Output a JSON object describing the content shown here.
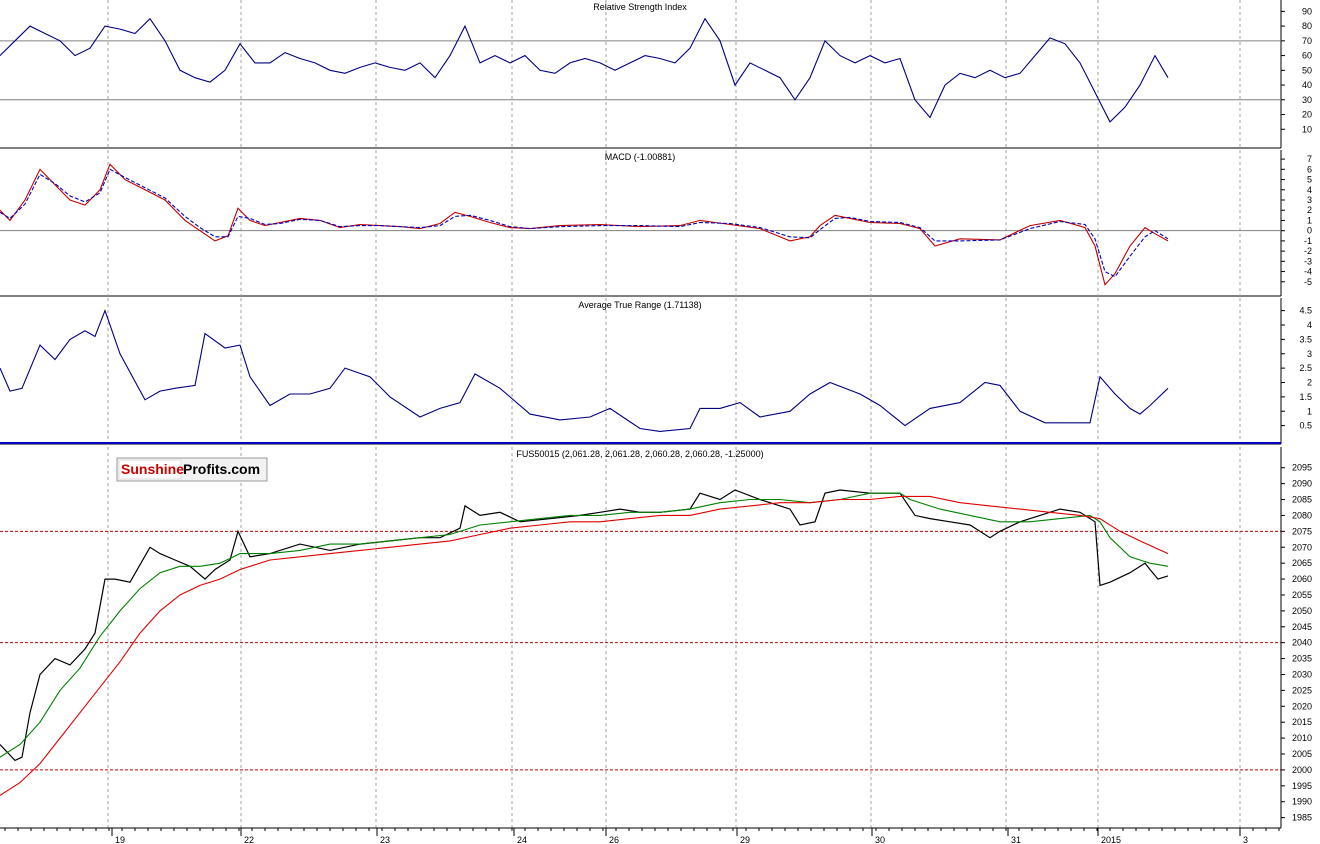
{
  "logo": {
    "sunshine": "Sunshine",
    "profits": "Profits.com"
  },
  "x_axis": {
    "labels": [
      "19",
      "22",
      "23",
      "24",
      "26",
      "29",
      "30",
      "31",
      "2015",
      "3"
    ]
  },
  "chart_data": [
    {
      "type": "line",
      "title": "Relative Strength Index",
      "ylim": [
        0,
        95
      ],
      "yticks": [
        10,
        20,
        30,
        40,
        50,
        60,
        70,
        80,
        90
      ],
      "reference_lines": [
        30,
        70
      ],
      "grid": true,
      "colors": {
        "series": "#000080"
      },
      "series": [
        {
          "x": [
            0,
            15,
            30,
            45,
            60,
            75,
            90,
            105,
            120,
            135,
            150,
            165,
            180,
            195,
            210,
            225,
            240,
            255,
            270,
            285,
            300,
            315,
            330,
            345,
            360,
            375,
            390,
            405,
            420,
            435,
            450,
            465,
            480,
            495,
            510,
            525,
            540,
            555,
            570,
            585,
            600,
            615,
            630,
            645,
            660,
            675,
            690,
            705,
            720,
            735,
            750,
            765,
            780,
            795,
            810,
            825,
            840,
            855,
            870,
            885,
            900,
            915,
            930,
            945,
            960,
            975,
            990,
            1005,
            1020,
            1035,
            1050,
            1065,
            1080,
            1095,
            1110,
            1125,
            1140,
            1155,
            1168
          ],
          "values": [
            60,
            70,
            80,
            75,
            70,
            60,
            65,
            80,
            78,
            75,
            85,
            70,
            50,
            45,
            42,
            50,
            68,
            55,
            55,
            62,
            58,
            55,
            50,
            48,
            52,
            55,
            52,
            50,
            55,
            45,
            60,
            80,
            55,
            60,
            55,
            60,
            50,
            48,
            55,
            58,
            55,
            50,
            55,
            60,
            58,
            55,
            65,
            85,
            70,
            40,
            55,
            50,
            45,
            30,
            45,
            70,
            60,
            55,
            60,
            55,
            58,
            30,
            18,
            40,
            48,
            45,
            50,
            45,
            48,
            60,
            72,
            68,
            55,
            35,
            15,
            25,
            40,
            60,
            45
          ]
        }
      ]
    },
    {
      "type": "line",
      "title": "MACD (-1.00881)",
      "ylim": [
        -6,
        7.5
      ],
      "yticks": [
        -5,
        -4,
        -3,
        -2,
        -1,
        0,
        1,
        2,
        3,
        4,
        5,
        6,
        7
      ],
      "reference_lines": [
        0
      ],
      "grid": true,
      "colors": {
        "macd": "#c00000",
        "signal": "#0000c0"
      },
      "series": [
        {
          "x": [
            0,
            10,
            25,
            40,
            55,
            70,
            85,
            100,
            110,
            125,
            145,
            165,
            185,
            200,
            215,
            228,
            238,
            250,
            265,
            280,
            300,
            320,
            340,
            360,
            380,
            400,
            420,
            440,
            455,
            470,
            490,
            510,
            530,
            560,
            600,
            640,
            680,
            700,
            730,
            760,
            790,
            810,
            820,
            835,
            850,
            870,
            900,
            920,
            935,
            960,
            1000,
            1030,
            1060,
            1085,
            1095,
            1105,
            1115,
            1130,
            1145,
            1155,
            1168
          ],
          "values": [
            2,
            1,
            3,
            6,
            4.5,
            3,
            2.5,
            4,
            6.5,
            5,
            4,
            3,
            1,
            0,
            -1,
            -0.5,
            2.2,
            1,
            0.5,
            0.8,
            1.2,
            1,
            0.3,
            0.6,
            0.5,
            0.4,
            0.2,
            0.7,
            1.8,
            1.4,
            0.8,
            0.3,
            0.2,
            0.5,
            0.6,
            0.4,
            0.5,
            1,
            0.6,
            0.2,
            -1,
            -0.6,
            0.5,
            1.5,
            1.2,
            0.8,
            0.7,
            0.2,
            -1.5,
            -0.8,
            -0.9,
            0.5,
            1,
            0.3,
            -1.5,
            -5.3,
            -4.2,
            -1.5,
            0.3,
            -0.3,
            -1
          ]
        },
        {
          "x": [
            0,
            10,
            25,
            40,
            55,
            70,
            85,
            100,
            110,
            125,
            145,
            165,
            185,
            200,
            215,
            228,
            238,
            250,
            265,
            280,
            300,
            320,
            340,
            360,
            380,
            400,
            420,
            440,
            455,
            470,
            490,
            510,
            530,
            560,
            600,
            640,
            680,
            700,
            730,
            760,
            790,
            810,
            820,
            835,
            850,
            870,
            900,
            920,
            935,
            960,
            1000,
            1030,
            1060,
            1085,
            1095,
            1105,
            1115,
            1130,
            1145,
            1155,
            1168
          ],
          "values": [
            1.8,
            1.2,
            2.6,
            5.5,
            4.6,
            3.4,
            2.8,
            3.7,
            6,
            5.2,
            4.2,
            3.2,
            1.4,
            0.3,
            -0.6,
            -0.6,
            1.4,
            1.2,
            0.6,
            0.7,
            1.1,
            1,
            0.4,
            0.5,
            0.5,
            0.4,
            0.3,
            0.5,
            1.4,
            1.5,
            1,
            0.4,
            0.2,
            0.4,
            0.5,
            0.5,
            0.4,
            0.8,
            0.7,
            0.3,
            -0.6,
            -0.7,
            0.1,
            1.2,
            1.3,
            0.9,
            0.8,
            0.3,
            -1,
            -1,
            -0.9,
            0.2,
            0.9,
            0.6,
            -0.8,
            -4,
            -4.5,
            -2.5,
            -0.6,
            0,
            -0.8
          ]
        }
      ]
    },
    {
      "type": "line",
      "title": "Average True Range (1.71138)",
      "ylim": [
        0,
        4.8
      ],
      "yticks": [
        0.5,
        1.0,
        1.5,
        2.0,
        2.5,
        3.0,
        3.5,
        4.0,
        4.5
      ],
      "grid": true,
      "colors": {
        "series": "#000080"
      },
      "series": [
        {
          "x": [
            0,
            10,
            22,
            40,
            55,
            70,
            85,
            95,
            105,
            120,
            145,
            160,
            175,
            195,
            205,
            225,
            240,
            250,
            270,
            290,
            310,
            330,
            345,
            370,
            390,
            420,
            440,
            460,
            475,
            500,
            530,
            560,
            590,
            610,
            640,
            660,
            690,
            700,
            720,
            740,
            760,
            790,
            810,
            830,
            860,
            880,
            905,
            930,
            960,
            985,
            1000,
            1020,
            1045,
            1070,
            1090,
            1100,
            1115,
            1130,
            1140,
            1150,
            1168
          ],
          "values": [
            2.5,
            1.7,
            1.8,
            3.3,
            2.8,
            3.5,
            3.8,
            3.6,
            4.5,
            3,
            1.4,
            1.7,
            1.8,
            1.9,
            3.7,
            3.2,
            3.3,
            2.2,
            1.2,
            1.6,
            1.6,
            1.8,
            2.5,
            2.2,
            1.5,
            0.8,
            1.1,
            1.3,
            2.3,
            1.8,
            0.9,
            0.7,
            0.8,
            1.1,
            0.4,
            0.3,
            0.4,
            1.1,
            1.1,
            1.3,
            0.8,
            1.0,
            1.6,
            2.0,
            1.6,
            1.2,
            0.5,
            1.1,
            1.3,
            2.0,
            1.9,
            1.0,
            0.6,
            0.6,
            0.6,
            2.2,
            1.6,
            1.1,
            0.9,
            1.2,
            1.8
          ]
        }
      ]
    },
    {
      "type": "line",
      "title": "FUS50015 (2,061.28, 2,061.28, 2,060.28, 2,060.28, -1.25000)",
      "ylim": [
        1983,
        2099
      ],
      "yticks": [
        1985,
        1990,
        1995,
        2000,
        2005,
        2010,
        2015,
        2020,
        2025,
        2030,
        2035,
        2040,
        2045,
        2050,
        2055,
        2060,
        2065,
        2070,
        2075,
        2080,
        2085,
        2090,
        2095
      ],
      "reference_lines": [
        2000,
        2040,
        2075
      ],
      "grid": true,
      "colors": {
        "price": "#000000",
        "ma_short": "#008000",
        "ma_long": "#e00000",
        "reference": "#c00000"
      },
      "series": [
        {
          "x": [
            0,
            15,
            22,
            30,
            40,
            55,
            70,
            85,
            95,
            105,
            115,
            130,
            150,
            160,
            175,
            190,
            205,
            215,
            230,
            238,
            250,
            270,
            300,
            330,
            360,
            390,
            420,
            440,
            460,
            465,
            480,
            500,
            520,
            550,
            580,
            600,
            620,
            640,
            660,
            690,
            700,
            720,
            735,
            760,
            790,
            800,
            815,
            825,
            840,
            870,
            900,
            915,
            930,
            950,
            970,
            990,
            1000,
            1020,
            1040,
            1060,
            1080,
            1095,
            1100,
            1110,
            1130,
            1145,
            1150,
            1158,
            1168
          ],
          "values": [
            2008,
            2003,
            2004,
            2018,
            2030,
            2035,
            2033,
            2038,
            2043,
            2060,
            2060,
            2059,
            2070,
            2068,
            2066,
            2064,
            2060,
            2063,
            2066,
            2075,
            2067,
            2068,
            2071,
            2069,
            2071,
            2072,
            2073,
            2073,
            2076,
            2083,
            2080,
            2081,
            2078,
            2079,
            2080,
            2081,
            2082,
            2081,
            2081,
            2082,
            2087,
            2085,
            2088,
            2085,
            2082,
            2077,
            2078,
            2087,
            2088,
            2087,
            2087,
            2080,
            2079,
            2078,
            2077,
            2073,
            2075,
            2078,
            2080,
            2082,
            2081,
            2078,
            2058,
            2059,
            2062,
            2065,
            2063,
            2060,
            2061
          ]
        },
        {
          "x": [
            0,
            20,
            40,
            60,
            80,
            100,
            120,
            140,
            160,
            180,
            200,
            220,
            240,
            270,
            300,
            330,
            360,
            390,
            420,
            450,
            480,
            510,
            540,
            570,
            600,
            630,
            660,
            690,
            720,
            750,
            780,
            810,
            840,
            870,
            900,
            910,
            940,
            970,
            1000,
            1030,
            1060,
            1090,
            1100,
            1110,
            1130,
            1150,
            1168
          ],
          "values": [
            2004,
            2008,
            2015,
            2025,
            2032,
            2042,
            2050,
            2057,
            2062,
            2064,
            2064,
            2065,
            2068,
            2068,
            2069,
            2071,
            2071,
            2072,
            2073,
            2074,
            2077,
            2078,
            2079,
            2080,
            2080,
            2081,
            2081,
            2082,
            2084,
            2085,
            2085,
            2084,
            2085,
            2087,
            2087,
            2085,
            2082,
            2080,
            2078,
            2078,
            2079,
            2080,
            2078,
            2073,
            2067,
            2065,
            2064
          ]
        },
        {
          "x": [
            0,
            20,
            40,
            60,
            80,
            100,
            120,
            140,
            160,
            180,
            200,
            220,
            240,
            270,
            300,
            330,
            360,
            390,
            420,
            450,
            480,
            510,
            540,
            570,
            600,
            630,
            660,
            690,
            720,
            750,
            780,
            810,
            840,
            870,
            900,
            930,
            960,
            990,
            1020,
            1050,
            1080,
            1100,
            1120,
            1140,
            1168
          ],
          "values": [
            1992,
            1996,
            2002,
            2010,
            2018,
            2026,
            2034,
            2043,
            2050,
            2055,
            2058,
            2060,
            2063,
            2066,
            2067,
            2068,
            2069,
            2070,
            2071,
            2072,
            2074,
            2076,
            2077,
            2078,
            2078,
            2079,
            2080,
            2080,
            2082,
            2083,
            2084,
            2084,
            2085,
            2085,
            2086,
            2086,
            2084,
            2083,
            2082,
            2081,
            2080,
            2079,
            2075,
            2072,
            2068
          ]
        }
      ]
    }
  ]
}
